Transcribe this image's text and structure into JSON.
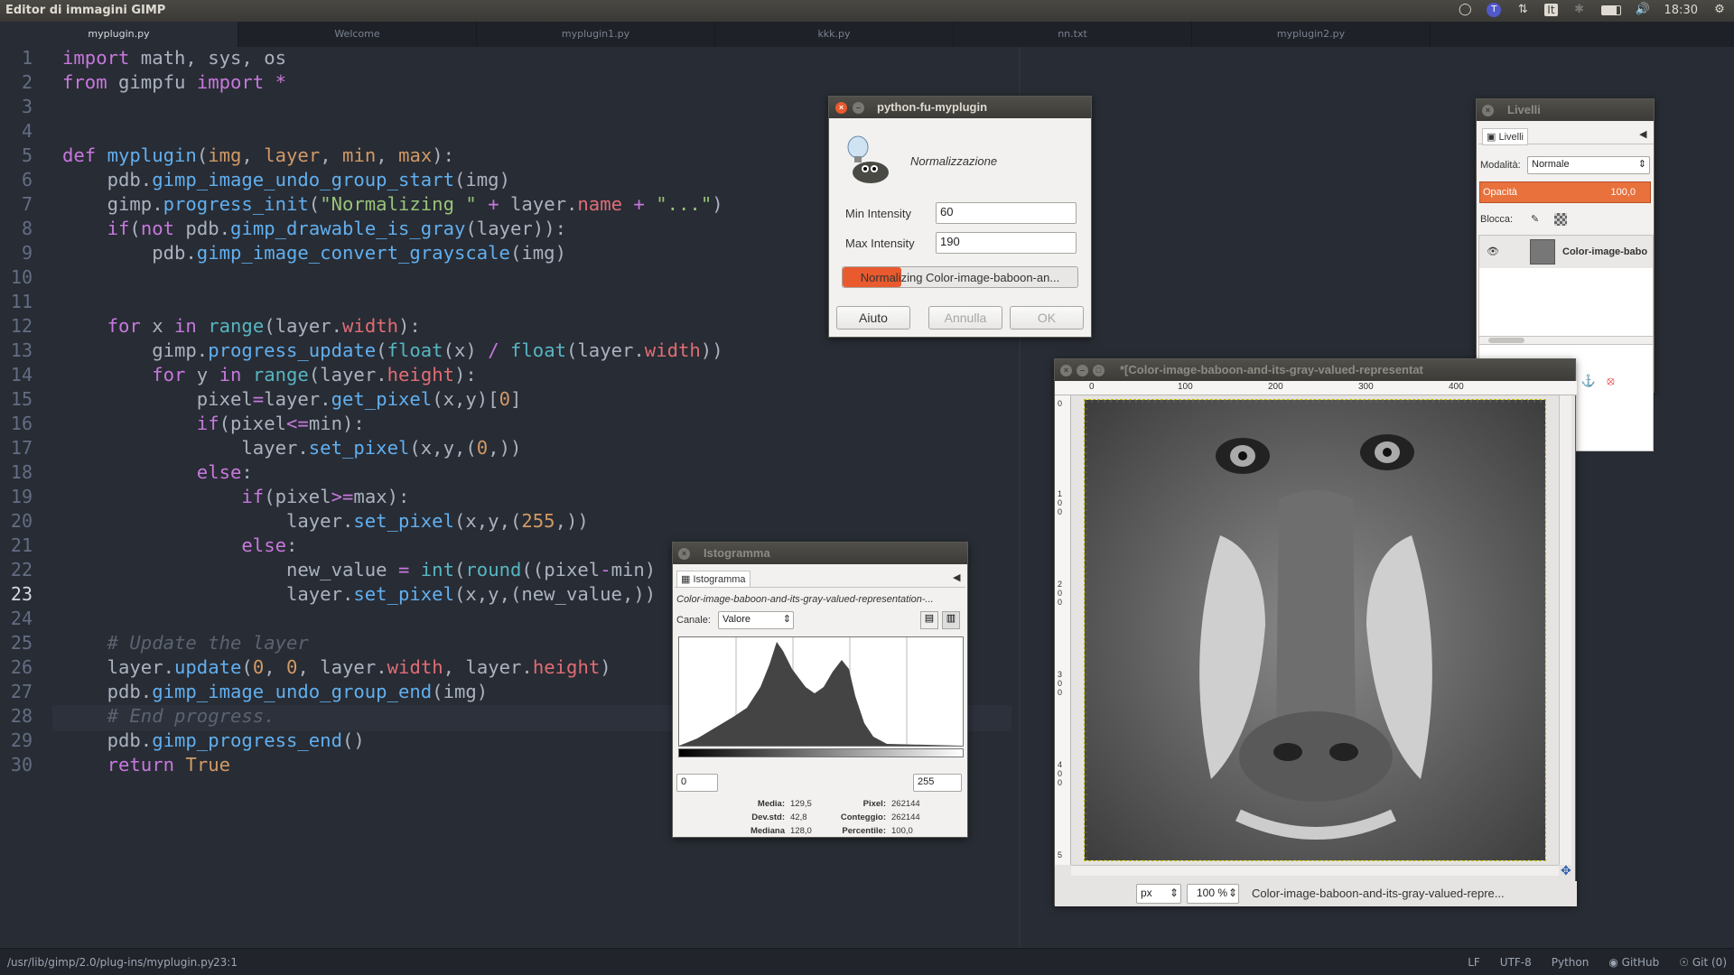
{
  "topbar": {
    "title": "Editor di immagini GIMP",
    "keyboard": "It",
    "clock": "18:30"
  },
  "tabs": [
    "myplugin.py",
    "Welcome",
    "myplugin1.py",
    "kkk.py",
    "nn.txt",
    "myplugin2.py"
  ],
  "code": {
    "line_numbers": [
      "1",
      "2",
      "3",
      "4",
      "5",
      "6",
      "7",
      "8",
      "9",
      "10",
      "11",
      "12",
      "13",
      "14",
      "15",
      "16",
      "17",
      "18",
      "19",
      "20",
      "21",
      "22",
      "23",
      "24",
      "25",
      "26",
      "27",
      "28",
      "29",
      "30"
    ],
    "current_line": 23
  },
  "status": {
    "path": "/usr/lib/gimp/2.0/plug-ins/myplugin.py",
    "cursor": "23:1",
    "eol": "LF",
    "encoding": "UTF-8",
    "grammar": "Python",
    "github": "GitHub",
    "git": "Git (0)"
  },
  "plugin_dialog": {
    "title": "python-fu-myplugin",
    "heading": "Normalizzazione",
    "min_label": "Min Intensity",
    "min_value": "60",
    "max_label": "Max Intensity",
    "max_value": "190",
    "progress_text": "Normalizing Color-image-baboon-an...",
    "progress": 0.25,
    "help": "Aiuto",
    "cancel": "Annulla",
    "ok": "OK"
  },
  "layers": {
    "title": "Livelli",
    "tab": "Livelli",
    "mode_label": "Modalità:",
    "mode": "Normale",
    "opacity_label": "Opacità",
    "opacity": "100,0",
    "lock_label": "Blocca:",
    "layer_name": "Color-image-babo"
  },
  "image_window": {
    "title": "*[Color-image-baboon-and-its-gray-valued-representat",
    "ruler_top": [
      "0",
      "100",
      "200",
      "300",
      "400"
    ],
    "ruler_left": [
      "0",
      "1 0 0",
      "2 0 0",
      "3 0 0",
      "4 0 0",
      "5"
    ],
    "unit": "px",
    "zoom": "100 %",
    "status": "Color-image-baboon-and-its-gray-valued-repre..."
  },
  "histogram": {
    "title": "Istogramma",
    "tab": "Istogramma",
    "image_name": "Color-image-baboon-and-its-gray-valued-representation-...",
    "channel_label": "Canale:",
    "channel": "Valore",
    "range_min": "0",
    "range_max": "255",
    "stats": {
      "media_label": "Media:",
      "media": "129,5",
      "devstd_label": "Dev.std:",
      "devstd": "42,8",
      "mediana_label": "Mediana",
      "mediana": "128,0",
      "pixel_label": "Pixel:",
      "pixel": "262144",
      "conteggio_label": "Conteggio:",
      "conteggio": "262144",
      "percentile_label": "Percentile:",
      "percentile": "100,0"
    }
  },
  "colors": {
    "accent": "#e95a2e",
    "editor_bg": "#282c34"
  }
}
